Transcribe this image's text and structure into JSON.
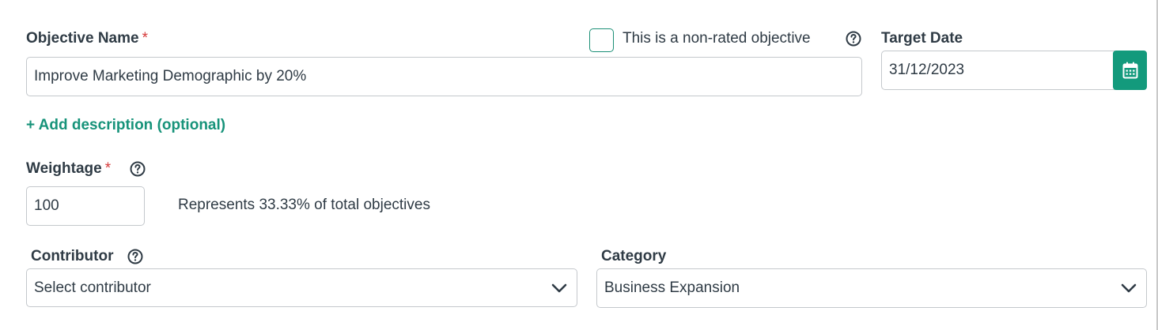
{
  "objective": {
    "label": "Objective Name",
    "required_mark": "*",
    "value": "Improve Marketing Demographic by 20%"
  },
  "non_rated": {
    "label": "This is a non-rated objective",
    "checked": false
  },
  "target_date": {
    "label": "Target Date",
    "value": "31/12/2023"
  },
  "description": {
    "add_label": "+ Add description (optional)"
  },
  "weightage": {
    "label": "Weightage",
    "required_mark": "*",
    "value": "100",
    "hint": "Represents 33.33% of total objectives"
  },
  "contributor": {
    "label": "Contributor",
    "selected": "Select contributor"
  },
  "category": {
    "label": "Category",
    "selected": "Business Expansion"
  },
  "colors": {
    "accent": "#139a7c",
    "link": "#17937a",
    "required": "#d63a3a",
    "text": "#2f3b45",
    "border": "#c4c8cc"
  },
  "icons": {
    "help": "help-circle-icon",
    "calendar": "calendar-icon",
    "dropdown": "chevron-down-icon"
  }
}
